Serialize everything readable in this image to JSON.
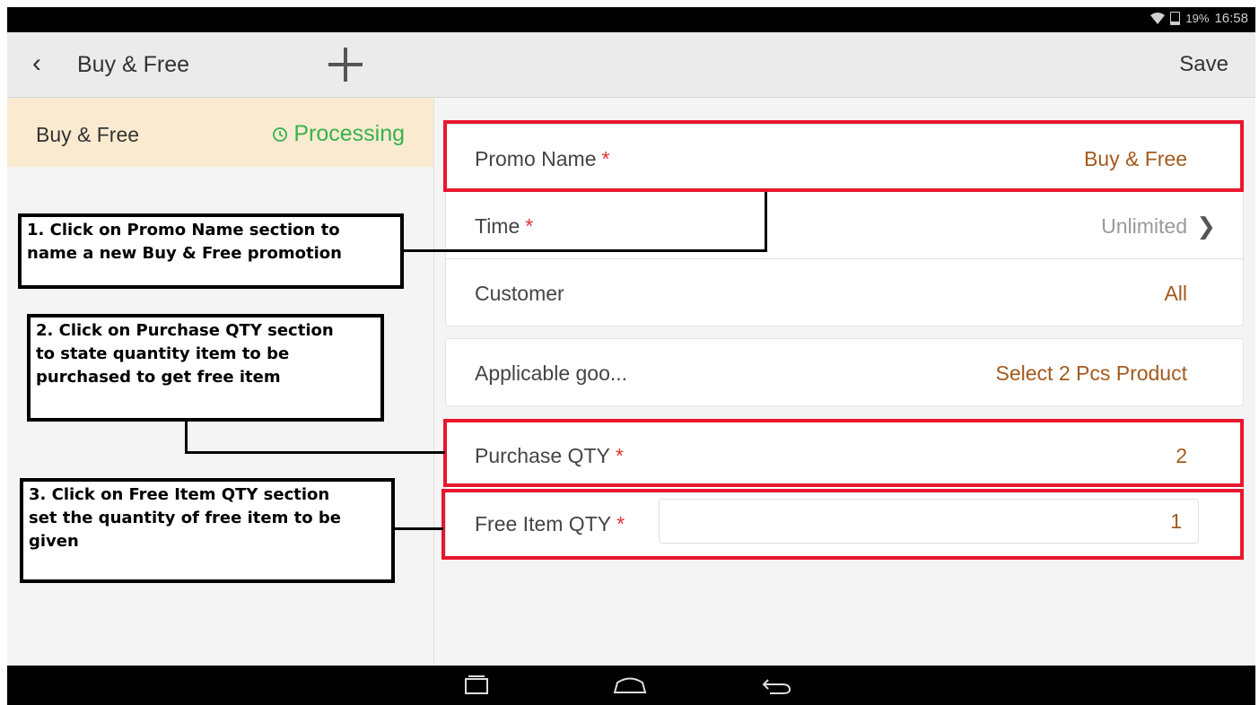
{
  "status_bar": {
    "battery": "19%",
    "time": "16:58"
  },
  "app_bar": {
    "back_glyph": "‹",
    "title": "Buy & Free",
    "save_label": "Save"
  },
  "left_panel": {
    "item_name": "Buy & Free",
    "item_status": "Processing",
    "status_color": "#37b24d"
  },
  "form": {
    "promo_name": {
      "label": "Promo Name",
      "required": "*",
      "value": "Buy & Free"
    },
    "time": {
      "label": "Time",
      "required": "*",
      "value": "Unlimited"
    },
    "customer": {
      "label": "Customer",
      "value": "All"
    },
    "applicable_goods": {
      "label": "Applicable goo...",
      "value": "Select 2 Pcs Product"
    },
    "purchase_qty": {
      "label": "Purchase QTY",
      "required": "*",
      "value": "2"
    },
    "free_item_qty": {
      "label": "Free Item QTY",
      "required": "*",
      "value": "1"
    }
  },
  "annotations": [
    "1. Click on Promo Name section to\nname a new Buy & Free promotion",
    "2. Click on Purchase QTY section\nto state quantity item to be\npurchased to get free item",
    "3. Click on Free Item QTY section\nset the quantity of free item to be\ngiven"
  ],
  "colors": {
    "value_text": "#a35a1c",
    "required_star": "#e03131",
    "highlight_box": "#e8172e",
    "selected_item_bg": "#faebd0"
  },
  "icons": [
    "wifi-icon",
    "battery-icon",
    "back-icon",
    "add-icon",
    "clock-icon",
    "chevron-right-icon",
    "recent-apps-icon",
    "home-icon",
    "back-nav-icon"
  ]
}
